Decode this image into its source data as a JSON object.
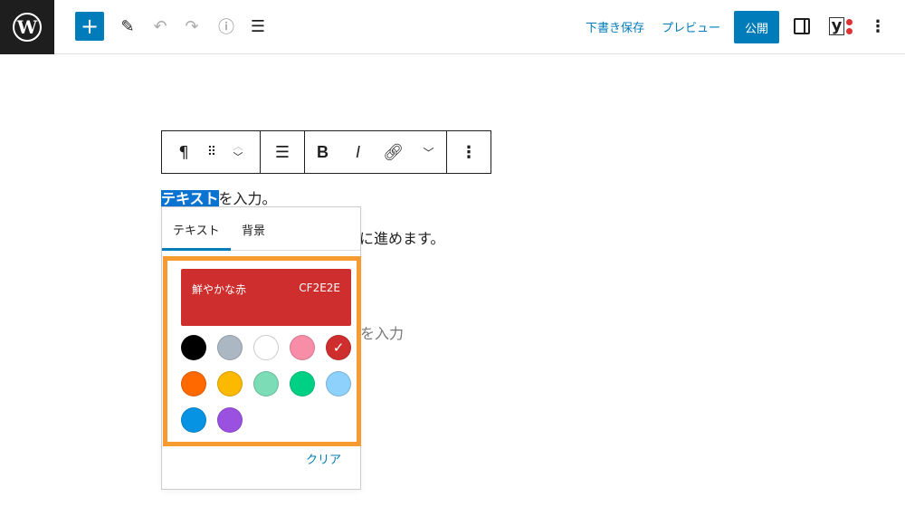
{
  "header": {
    "save_draft": "下書き保存",
    "preview": "プレビュー",
    "publish": "公開"
  },
  "toolbar": {
    "paragraph": "¶",
    "bold": "B",
    "italic": "I"
  },
  "content": {
    "selected": "テキスト",
    "line1_rest": "を入力。",
    "line2_partial": "ッに進めます。",
    "line3_partial": "を入力"
  },
  "popover": {
    "tabs": [
      "テキスト",
      "背景"
    ],
    "selected_color_name": "鮮やかな赤",
    "selected_color_hex": "CF2E2E",
    "clear": "クリア",
    "colors": [
      "#000000",
      "#abb8c3",
      "#ffffff",
      "#f78da7",
      "#cf2e2e",
      "#ff6900",
      "#fcb900",
      "#7bdcb5",
      "#00d084",
      "#8ed1fc",
      "#0693e3",
      "#9b51e0"
    ],
    "selected_index": 4
  },
  "accent": "#007cba"
}
